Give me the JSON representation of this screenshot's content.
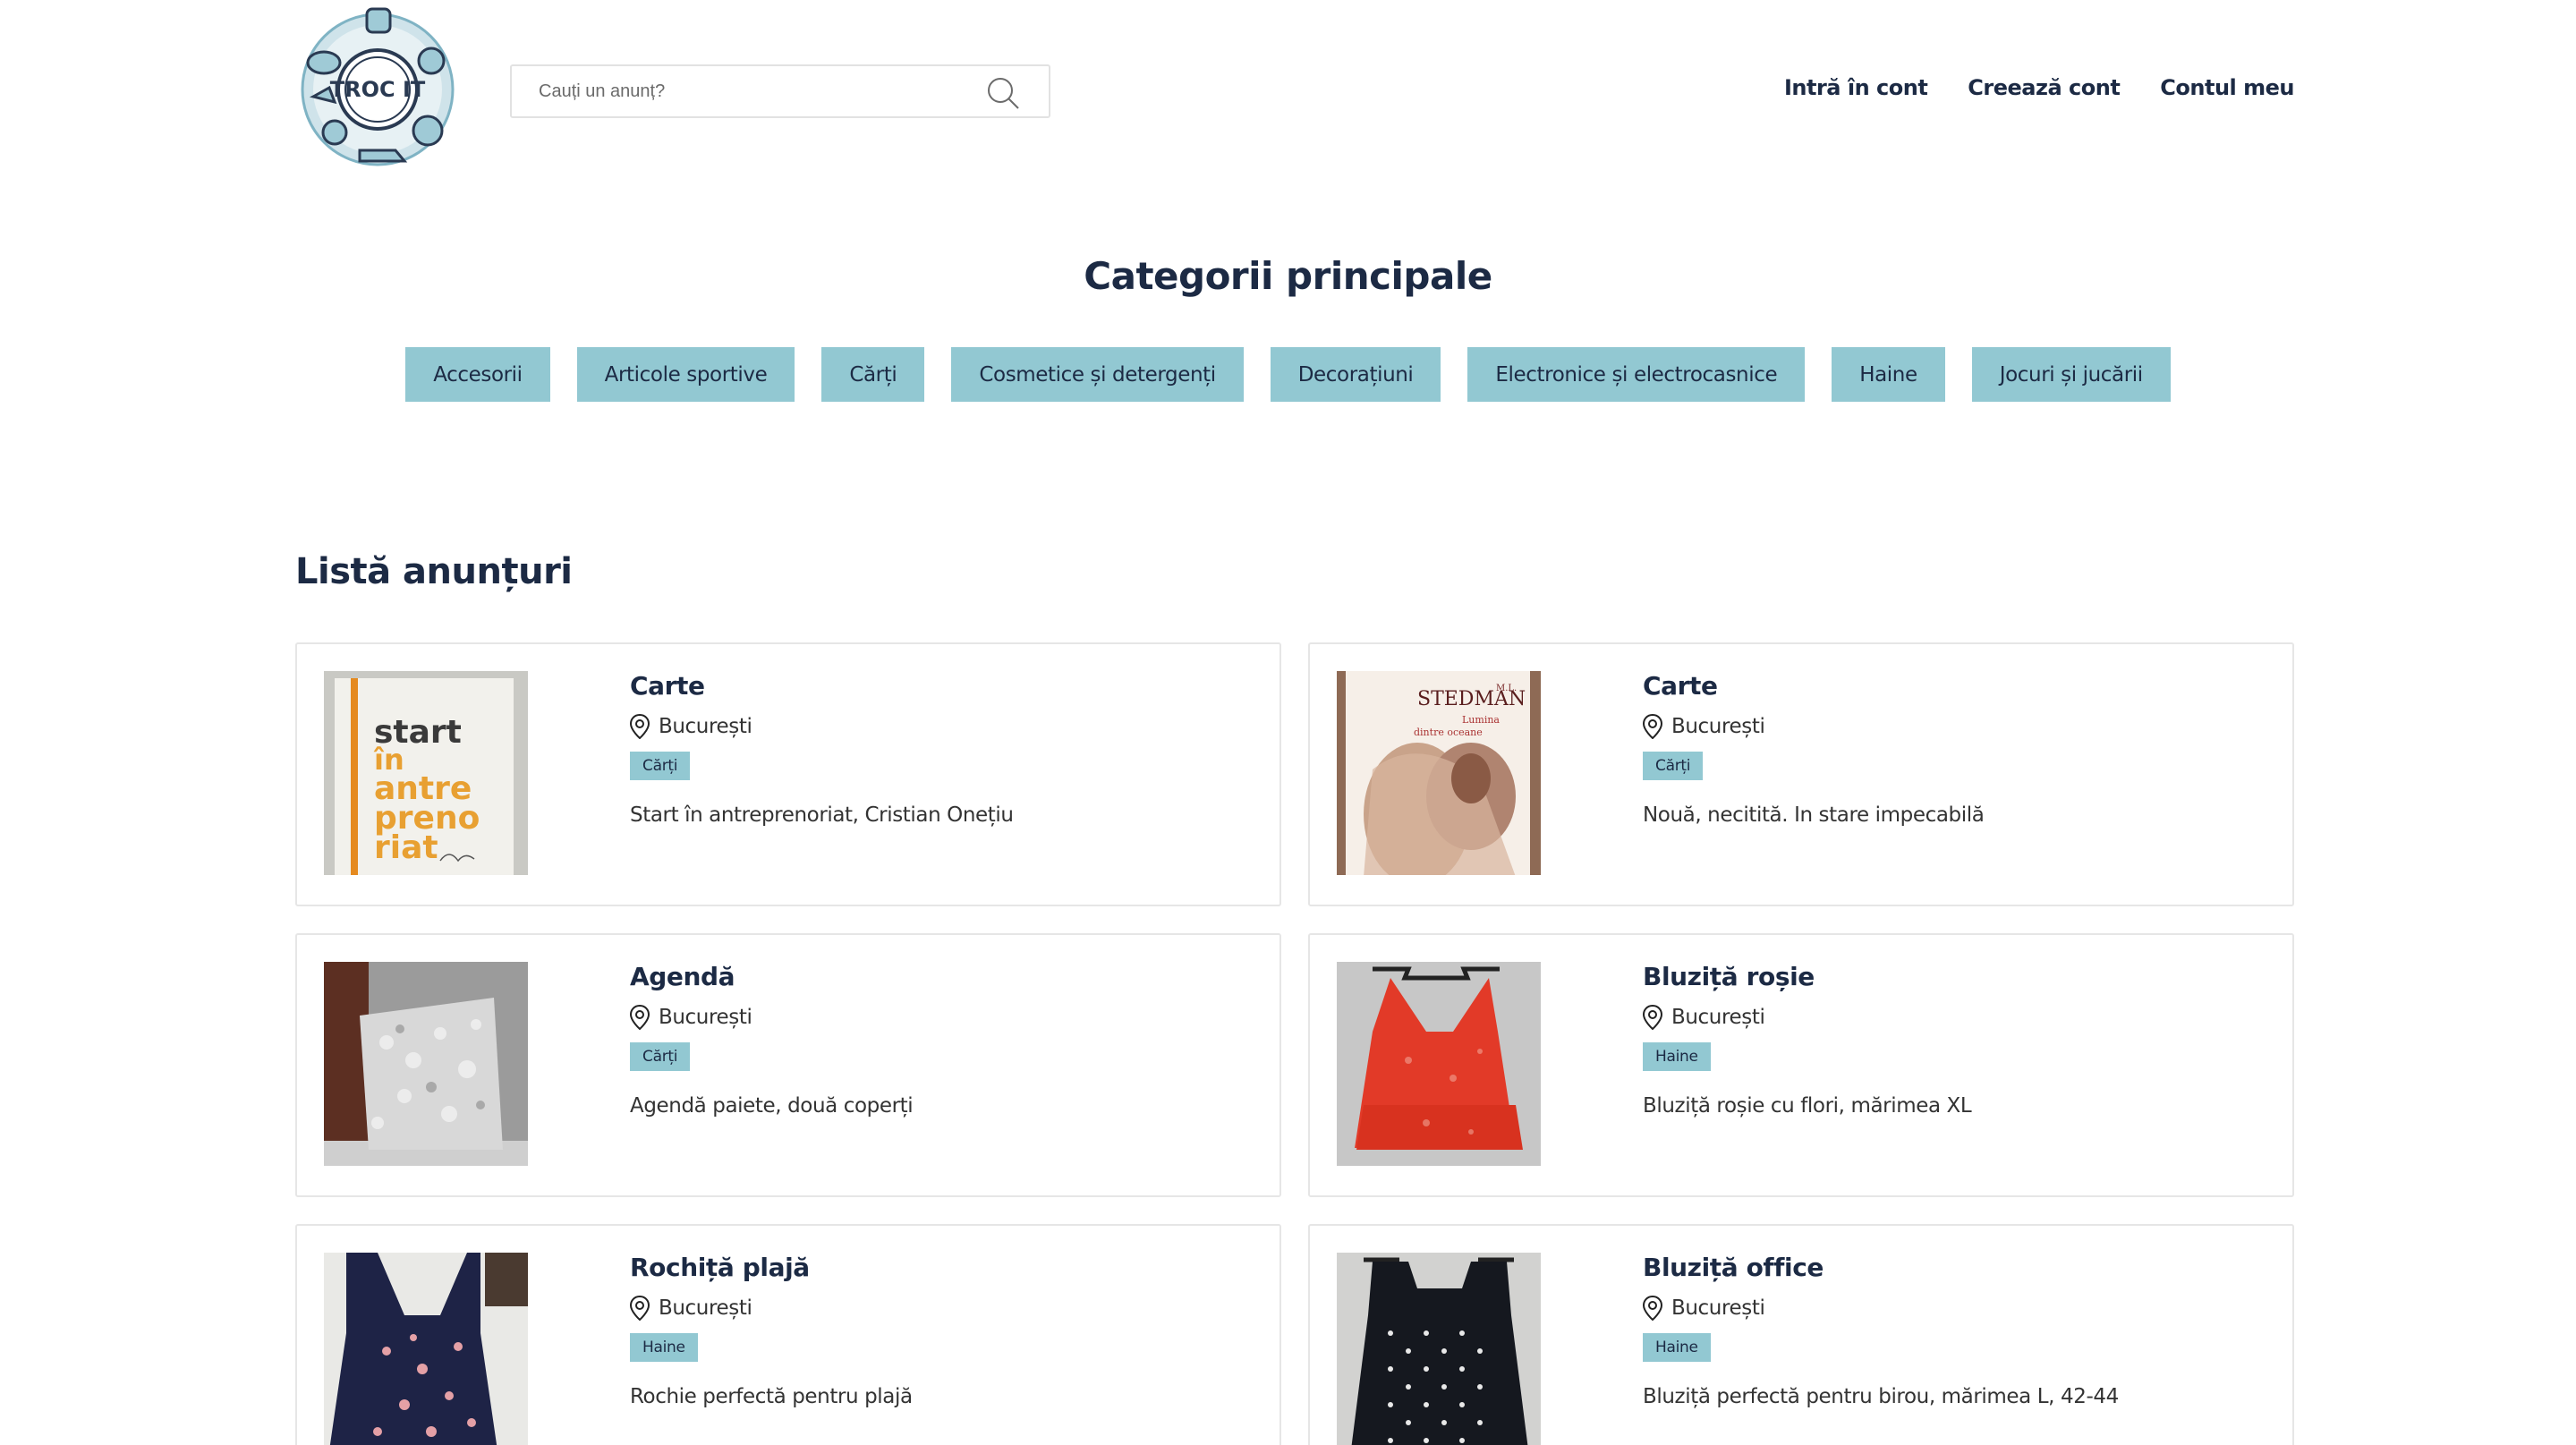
{
  "header": {
    "logo_text": "TROC IT",
    "search_placeholder": "Cauți un anunț?",
    "nav": [
      "Intră în cont",
      "Creează cont",
      "Contul meu"
    ]
  },
  "categories": {
    "title": "Categorii principale",
    "items": [
      "Accesorii",
      "Articole sportive",
      "Cărți",
      "Cosmetice și detergenți",
      "Decorațiuni",
      "Electronice și electrocasnice",
      "Haine",
      "Jocuri și jucării"
    ]
  },
  "listings": {
    "title": "Listă anunțuri",
    "items": [
      {
        "title": "Carte",
        "location": "București",
        "category": "Cărți",
        "description": "Start în antreprenoriat, Cristian Onețiu",
        "image": "book-start-in-antreprenoriat",
        "image_text": [
          "start",
          "în",
          "antre",
          "preno",
          "riat"
        ]
      },
      {
        "title": "Carte",
        "location": "București",
        "category": "Cărți",
        "description": "Nouă, necitită. In stare impecabilă",
        "image": "book-stedman",
        "image_text": [
          "M.L.",
          "STEDMAN",
          "Lumina",
          "dintre oceane"
        ]
      },
      {
        "title": "Agendă",
        "location": "București",
        "category": "Cărți",
        "description": "Agendă paiete, două coperți",
        "image": "sequin-agenda"
      },
      {
        "title": "Bluziță roșie",
        "location": "București",
        "category": "Haine",
        "description": "Bluziță roșie cu flori, mărimea XL",
        "image": "red-blouse"
      },
      {
        "title": "Rochiță plajă",
        "location": "București",
        "category": "Haine",
        "description": "Rochie perfectă pentru plajă",
        "image": "beach-dress"
      },
      {
        "title": "Bluziță office",
        "location": "București",
        "category": "Haine",
        "description": "Bluziță perfectă pentru birou, mărimea L, 42-44",
        "image": "office-blouse"
      }
    ]
  },
  "colors": {
    "accent": "#92c8d2",
    "heading": "#1c2a44",
    "border": "#e6e6e6"
  }
}
